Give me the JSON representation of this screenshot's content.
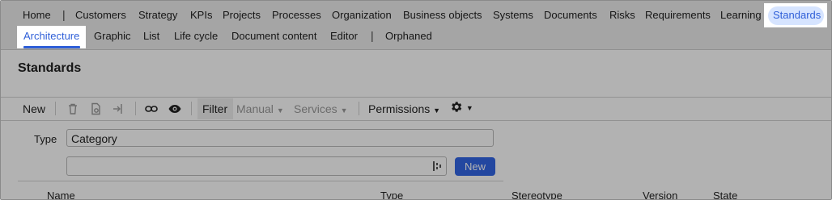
{
  "top_nav": {
    "items": [
      "Home",
      "Customers",
      "Strategy",
      "KPIs",
      "Projects",
      "Processes",
      "Organization",
      "Business objects",
      "Systems",
      "Documents",
      "Risks",
      "Requirements",
      "Learning"
    ],
    "active": "Standards"
  },
  "sub_nav": {
    "active": "Architecture",
    "items": [
      "Graphic",
      "List",
      "Life cycle",
      "Document content",
      "Editor"
    ],
    "orphaned": "Orphaned"
  },
  "page": {
    "title": "Standards"
  },
  "toolbar": {
    "new": "New",
    "filter": "Filter",
    "manual": "Manual",
    "services": "Services",
    "permissions": "Permissions",
    "icons": [
      "trash-icon",
      "document-icon",
      "export-icon",
      "link-icon",
      "eye-icon",
      "gear-icon"
    ]
  },
  "form": {
    "type_label": "Type",
    "type_value": "Category",
    "search_value": "",
    "new_button": "New"
  },
  "table": {
    "columns": [
      "Name",
      "Type",
      "Stereotype",
      "Version",
      "State"
    ]
  },
  "colors": {
    "accent": "#3366e6",
    "active_text": "#2f5fd8",
    "active_pill": "#d6e4ff"
  }
}
